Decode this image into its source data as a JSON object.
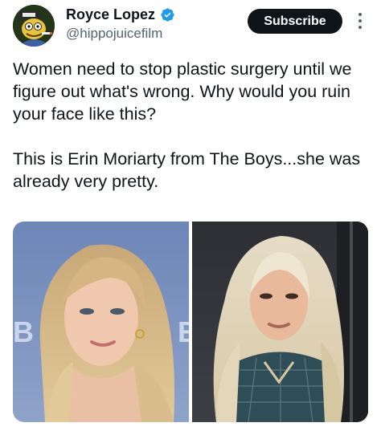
{
  "author": {
    "name": "Royce Lopez",
    "handle": "@hippojuicefilm",
    "verified": true,
    "avatar_icon": "cartoon-character-avatar"
  },
  "actions": {
    "subscribe_label": "Subscribe",
    "more_icon": "vertical-ellipsis-icon"
  },
  "tweet": {
    "line1": "Women need to stop plastic surgery until we figure out what's wrong. Why would you ruin your face like this?",
    "line2": "This is Erin Moriarty from The Boys...she was already very pretty."
  },
  "media": {
    "photo_count": 2
  },
  "colors": {
    "verified_blue": "#1d9bf0",
    "text": "#0f1419",
    "secondary": "#536471"
  }
}
